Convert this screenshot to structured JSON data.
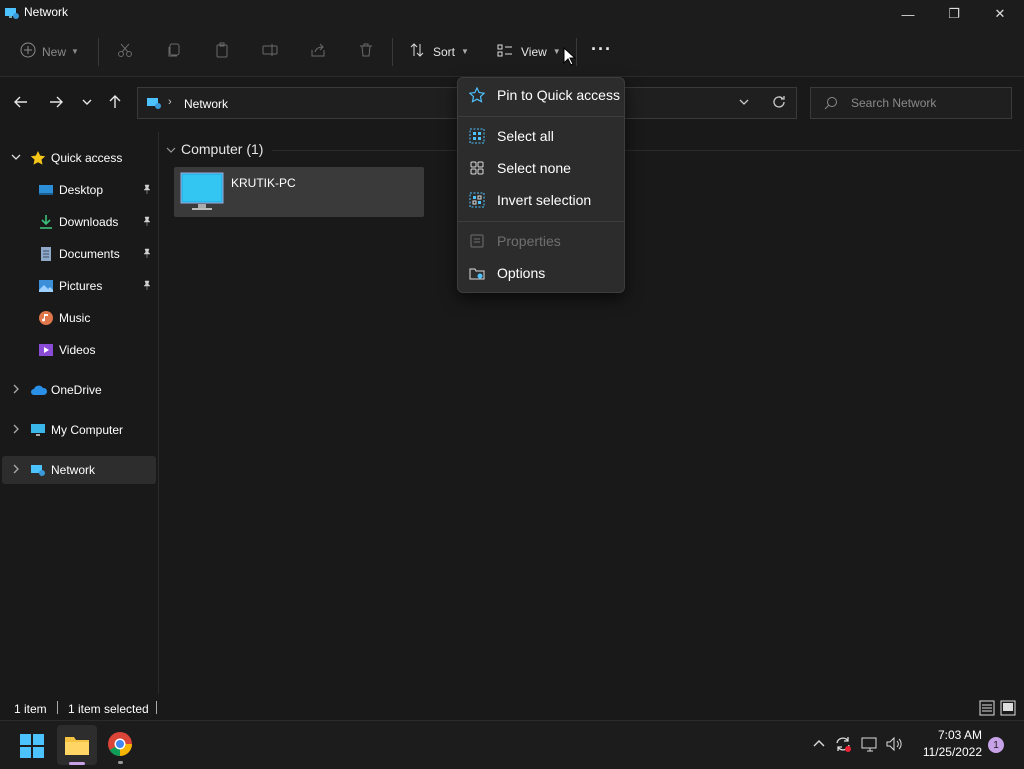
{
  "window": {
    "title": "Network",
    "minimize": "—",
    "maximize": "❐",
    "close": "✕"
  },
  "toolbar": {
    "new_label": "New",
    "sort_label": "Sort",
    "view_label": "View",
    "more_label": "···"
  },
  "nav": {
    "address_path": "Network",
    "search_placeholder": "Search Network"
  },
  "sidebar": {
    "quick_access": "Quick access",
    "items": [
      {
        "label": "Desktop",
        "icon": "desktop-icon",
        "pinned": true
      },
      {
        "label": "Downloads",
        "icon": "downloads-icon",
        "pinned": true
      },
      {
        "label": "Documents",
        "icon": "documents-icon",
        "pinned": true
      },
      {
        "label": "Pictures",
        "icon": "pictures-icon",
        "pinned": true
      },
      {
        "label": "Music",
        "icon": "music-icon",
        "pinned": false
      },
      {
        "label": "Videos",
        "icon": "videos-icon",
        "pinned": false
      }
    ],
    "onedrive": "OneDrive",
    "my_computer": "My Computer",
    "network": "Network"
  },
  "content": {
    "group_header": "Computer (1)",
    "items": [
      {
        "label": "KRUTIK-PC",
        "icon": "monitor-icon"
      }
    ]
  },
  "menu": {
    "items": [
      {
        "label": "Pin to Quick access",
        "icon": "star-icon",
        "disabled": false
      },
      {
        "label": "Select all",
        "icon": "select-all-icon",
        "disabled": false
      },
      {
        "label": "Select none",
        "icon": "select-none-icon",
        "disabled": false
      },
      {
        "label": "Invert selection",
        "icon": "invert-selection-icon",
        "disabled": false
      },
      {
        "label": "Properties",
        "icon": "properties-icon",
        "disabled": true
      },
      {
        "label": "Options",
        "icon": "options-icon",
        "disabled": false
      }
    ]
  },
  "status": {
    "count": "1 item",
    "selected": "1 item selected"
  },
  "taskbar": {
    "time": "7:03 AM",
    "date": "11/25/2022",
    "notification_count": "1"
  },
  "colors": {
    "accent": "#4cc2ff",
    "background": "#191919",
    "menu_bg": "#2c2c2c",
    "selected_tile": "#3a3a3a",
    "badge": "#c8a2e6"
  }
}
